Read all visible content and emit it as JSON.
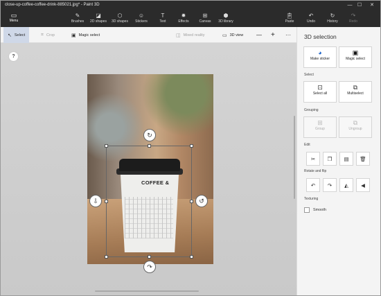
{
  "window": {
    "title": "close-up-coffee-coffee-drink-885021.jpg* - Paint 3D",
    "minimize": "—",
    "maximize": "☐",
    "close": "✕"
  },
  "ribbon": {
    "menu": {
      "label": "Menu",
      "icon": "folder-icon"
    },
    "tools": [
      {
        "label": "Brushes",
        "icon": "brush-icon"
      },
      {
        "label": "2D shapes",
        "icon": "2d-shapes-icon"
      },
      {
        "label": "3D shapes",
        "icon": "3d-shapes-icon"
      },
      {
        "label": "Stickers",
        "icon": "stickers-icon"
      },
      {
        "label": "Text",
        "icon": "text-icon"
      },
      {
        "label": "Effects",
        "icon": "effects-icon"
      },
      {
        "label": "Canvas",
        "icon": "canvas-icon"
      },
      {
        "label": "3D library",
        "icon": "3d-library-icon"
      }
    ],
    "right_tools": [
      {
        "label": "Paste",
        "icon": "paste-icon"
      },
      {
        "label": "Undo",
        "icon": "undo-icon"
      },
      {
        "label": "History",
        "icon": "history-icon"
      },
      {
        "label": "Redo",
        "icon": "redo-icon"
      }
    ]
  },
  "toolbar": {
    "select": "Select",
    "crop": "Crop",
    "magic_select": "Magic select",
    "mixed_reality": "Mixed reality",
    "view_3d": "3D view",
    "zoom_out": "—",
    "zoom_in": "+",
    "more": "···"
  },
  "canvas": {
    "help": "?",
    "cup_text": "COFFEE &"
  },
  "panel": {
    "title": "3D selection",
    "top_buttons": [
      {
        "label": "Make sticker",
        "icon": "sticker-icon"
      },
      {
        "label": "Magic select",
        "icon": "magic-select-icon"
      }
    ],
    "sections": {
      "select": "Select",
      "grouping": "Grouping",
      "edit": "Edit",
      "rotate": "Rotate and flip",
      "texturing": "Texturing"
    },
    "select_buttons": [
      {
        "label": "Select all",
        "icon": "select-all-icon"
      },
      {
        "label": "Multiselect",
        "icon": "multiselect-icon"
      }
    ],
    "grouping_buttons": [
      {
        "label": "Group",
        "icon": "group-icon"
      },
      {
        "label": "Ungroup",
        "icon": "ungroup-icon"
      }
    ],
    "edit_buttons": [
      {
        "icon": "cut-icon"
      },
      {
        "icon": "copy-icon"
      },
      {
        "icon": "paste-icon"
      },
      {
        "icon": "delete-icon"
      }
    ],
    "rotate_buttons": [
      {
        "icon": "rotate-left-icon"
      },
      {
        "icon": "rotate-right-icon"
      },
      {
        "icon": "flip-vertical-icon"
      },
      {
        "icon": "flip-horizontal-icon"
      }
    ],
    "smooth_label": "Smooth"
  }
}
